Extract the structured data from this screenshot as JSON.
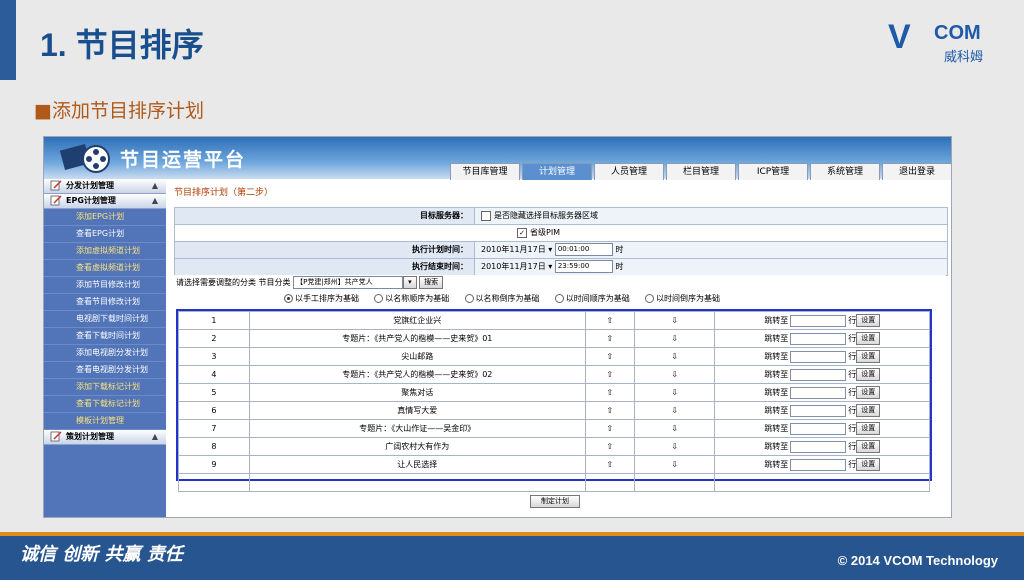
{
  "slide": {
    "title": "1. 节目排序",
    "bullet": "添加节目排序计划",
    "bullet_marker": "■",
    "logo_brand": "COM",
    "logo_cn": "威科姆",
    "slogan": "诚信 创新 共赢 责任",
    "copyright": "© 2014 VCOM Technology"
  },
  "app": {
    "title": "节目运营平台",
    "tabs": [
      {
        "label": "节目库管理",
        "active": false
      },
      {
        "label": "计划管理",
        "active": true
      },
      {
        "label": "人员管理",
        "active": false
      },
      {
        "label": "栏目管理",
        "active": false
      },
      {
        "label": "ICP管理",
        "active": false
      },
      {
        "label": "系统管理",
        "active": false
      },
      {
        "label": "退出登录",
        "active": false
      }
    ]
  },
  "sidebar": {
    "group1": "分发计划管理",
    "group2": "EPG计划管理",
    "items": [
      {
        "label": "添加EPG计划",
        "highlight": true
      },
      {
        "label": "查看EPG计划",
        "highlight": false
      },
      {
        "label": "添加虚拟频道计划",
        "highlight": true
      },
      {
        "label": "查看虚拟频道计划",
        "highlight": true
      },
      {
        "label": "添加节目修改计划",
        "highlight": false
      },
      {
        "label": "查看节目修改计划",
        "highlight": false
      },
      {
        "label": "电视剧下载时间计划",
        "highlight": false
      },
      {
        "label": "查看下载时间计划",
        "highlight": false
      },
      {
        "label": "添加电视剧分发计划",
        "highlight": false
      },
      {
        "label": "查看电视剧分发计划",
        "highlight": false
      },
      {
        "label": "添加下载标记计划",
        "highlight": true
      },
      {
        "label": "查看下载标记计划",
        "highlight": true
      },
      {
        "label": "模板计划管理",
        "highlight": true
      }
    ],
    "group3": "策划计划管理"
  },
  "form": {
    "crumb": "节目排序计划（第二步）",
    "target_label": "目标服务器：",
    "hide_option": "是否隐藏选择目标服务器区域",
    "pim_option": "省级PIM",
    "exec_label": "执行计划时间：",
    "exec_date": "2010年11月17日",
    "exec_time": "00:01:00",
    "end_label": "执行结束时间：",
    "end_date": "2010年11月17日",
    "end_time": "23:59:00",
    "time_unit": "时",
    "category_prompt": "请选择需要调整的分类",
    "category_label": "节目分类",
    "category_value": "【P党建|郑州】共产党人",
    "search_button": "搜索",
    "sort_options": [
      "以手工排序为基础",
      "以名称顺序为基础",
      "以名称倒序为基础",
      "以时间顺序为基础",
      "以时间倒序为基础"
    ],
    "submit_button": "制定计划"
  },
  "table": {
    "up_symbol": "⇧",
    "down_symbol": "⇩",
    "jump_label": "跳转至",
    "row_suffix": "行",
    "set_button": "设置",
    "rows": [
      {
        "index": "1",
        "name": "党旗红企业兴"
      },
      {
        "index": "2",
        "name": "专题片：《共产党人的楷模——史来贺》01"
      },
      {
        "index": "3",
        "name": "尖山邮路"
      },
      {
        "index": "4",
        "name": "专题片：《共产党人的楷模——史来贺》02"
      },
      {
        "index": "5",
        "name": "聚焦对话"
      },
      {
        "index": "6",
        "name": "真情写大爱"
      },
      {
        "index": "7",
        "name": "专题片：《大山作证——吴金印》"
      },
      {
        "index": "8",
        "name": "广阔农村大有作为"
      },
      {
        "index": "9",
        "name": "让人民选择"
      }
    ]
  },
  "colors": {
    "accent": "#1a4f8f",
    "header": "#2e6fb8",
    "sidebar": "#5175b8",
    "footer": "#27558f"
  }
}
